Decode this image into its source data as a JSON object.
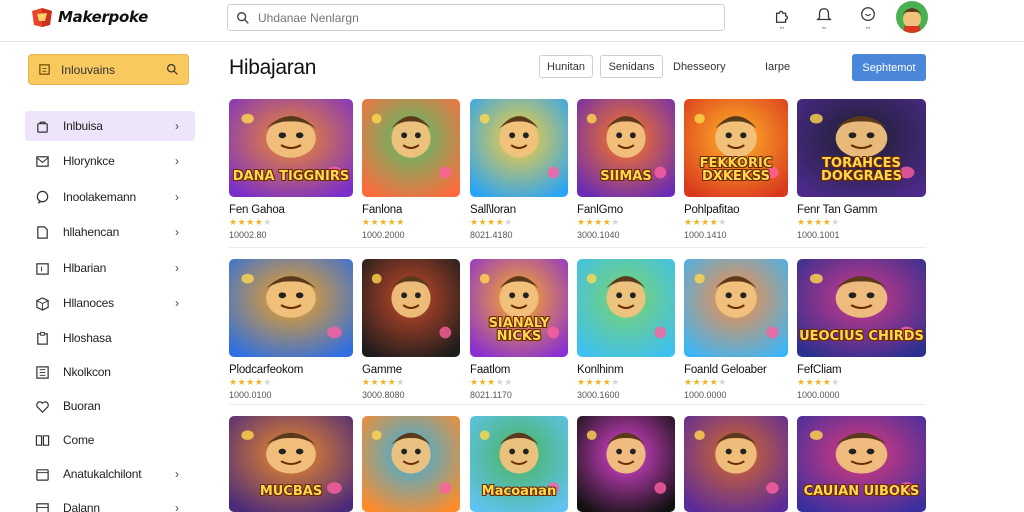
{
  "app": {
    "name": "Makerpoke"
  },
  "search": {
    "placeholder": "Uhdanae Nenlargn"
  },
  "sidebar": {
    "cta_label": "Inlouvains",
    "items": [
      {
        "label": "Inlbuisa",
        "icon": "bag-icon",
        "chevron": true,
        "active": true
      },
      {
        "label": "Hlorynkce",
        "icon": "mail-icon",
        "chevron": true
      },
      {
        "label": "Inoolakemann",
        "icon": "chat-icon",
        "chevron": true
      },
      {
        "label": "hllahencan",
        "icon": "document-icon",
        "chevron": true
      },
      {
        "label": "Hlbarian",
        "icon": "calendar-icon",
        "chevron": true
      },
      {
        "label": "Hllanoces",
        "icon": "box-icon",
        "chevron": true
      },
      {
        "label": "Hloshasa",
        "icon": "clipboard-icon",
        "chevron": false
      },
      {
        "label": "Nkolkcon",
        "icon": "list-icon",
        "chevron": false
      },
      {
        "label": "Buoran",
        "icon": "heart-icon",
        "chevron": false
      },
      {
        "label": "Come",
        "icon": "book-icon",
        "chevron": false
      },
      {
        "label": "Anatukalchilont",
        "icon": "folder-icon",
        "chevron": true
      },
      {
        "label": "Dalann",
        "icon": "archive-icon",
        "chevron": true
      }
    ]
  },
  "main": {
    "title": "Hibajaran",
    "chips": [
      "Hunitan",
      "Senidans"
    ],
    "tabs": [
      "Dhesseory",
      "Iarpe"
    ],
    "primary_button": "Sephtemot"
  },
  "cards": [
    {
      "title": "Fen Gahoa",
      "rating": 4,
      "count": "10002.80",
      "art": "DANA TIGGNIRS",
      "palette": [
        "#7a2fc9",
        "#f28c28"
      ]
    },
    {
      "title": "Fanlona",
      "rating": 5,
      "count": "1000.2000",
      "art": "",
      "palette": [
        "#ff6b3d",
        "#4ec36a"
      ]
    },
    {
      "title": "Sall\\loran",
      "rating": 4,
      "count": "8021.4180",
      "art": "",
      "palette": [
        "#2aa4f4",
        "#ffcf33"
      ]
    },
    {
      "title": "FanlGmo",
      "rating": 4,
      "count": "3000.1040",
      "art": "SIIMAS",
      "palette": [
        "#6a2bb5",
        "#ff7a1a"
      ]
    },
    {
      "title": "Pohlpafitao",
      "rating": 4,
      "count": "1000.1410",
      "art": "FEKKORIC DXKEKSS",
      "palette": [
        "#d9381e",
        "#ffb627"
      ]
    },
    {
      "title": "Fenr Tan Gamm",
      "rating": 4,
      "count": "1000.1001",
      "art": "TORAHCES DOKGRAES",
      "palette": [
        "#4b2a8a",
        "#1e1e2e"
      ]
    },
    {
      "title": "Plodcarfeokom",
      "rating": 4,
      "count": "1000.0100",
      "art": "",
      "palette": [
        "#2f6fe0",
        "#f7a21b"
      ]
    },
    {
      "title": "Gamme",
      "rating": 4,
      "count": "3000.8080",
      "art": "",
      "palette": [
        "#1c1c1c",
        "#c94a2b"
      ]
    },
    {
      "title": "Faatlom",
      "rating": 3,
      "count": "8021.1170",
      "art": "SIANALY NICKS",
      "palette": [
        "#8a2fd1",
        "#ffb020"
      ]
    },
    {
      "title": "Konlhinm",
      "rating": 4,
      "count": "3000.1600",
      "art": "",
      "palette": [
        "#3ec0f0",
        "#7bd36a"
      ]
    },
    {
      "title": "Foanld Geloaber",
      "rating": 4,
      "count": "1000.0000",
      "art": "",
      "palette": [
        "#3db5f5",
        "#ff8a3d"
      ]
    },
    {
      "title": "FefCliam",
      "rating": 4,
      "count": "1000.0000",
      "art": "UEOCIUS CHIRDS",
      "palette": [
        "#2b2f8f",
        "#d33a8a"
      ]
    },
    {
      "title": "",
      "rating": 0,
      "count": "",
      "art": "MUCBAS",
      "palette": [
        "#4a2a7a",
        "#f28c28"
      ]
    },
    {
      "title": "",
      "rating": 0,
      "count": "",
      "art": "",
      "palette": [
        "#ff8b2a",
        "#2fb3e6"
      ]
    },
    {
      "title": "",
      "rating": 0,
      "count": "",
      "art": "Macoanan",
      "palette": [
        "#5fc3f2",
        "#4bb35a"
      ]
    },
    {
      "title": "",
      "rating": 0,
      "count": "",
      "art": "",
      "palette": [
        "#111111",
        "#e445d8"
      ]
    },
    {
      "title": "",
      "rating": 0,
      "count": "",
      "art": "",
      "palette": [
        "#5a2a9a",
        "#d86a2a"
      ]
    },
    {
      "title": "",
      "rating": 0,
      "count": "",
      "art": "CAUIAN UIBOKS",
      "palette": [
        "#3a2f9f",
        "#e23a7a"
      ]
    }
  ],
  "colors": {
    "accent": "#4a86d9",
    "cta": "#f8c95e",
    "active_nav": "#efe5fb",
    "star": "#f0b429"
  }
}
